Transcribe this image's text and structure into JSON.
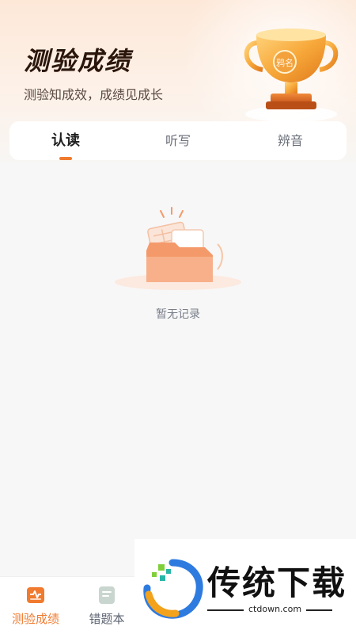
{
  "header": {
    "title": "测验成绩",
    "subtitle": "测验知成效，成绩见成长",
    "trophy_badge": "鸦名"
  },
  "tabs": [
    {
      "label": "认读",
      "active": true
    },
    {
      "label": "听写",
      "active": false
    },
    {
      "label": "辨音",
      "active": false
    }
  ],
  "empty_state": {
    "icon": "empty-folder-icon",
    "text": "暂无记录"
  },
  "bottom_nav": {
    "items": [
      {
        "label": "测验成绩",
        "icon": "report-icon",
        "active": true
      },
      {
        "label": "错题本",
        "icon": "notebook-icon",
        "active": false
      }
    ]
  },
  "watermark": {
    "text": "传统下载",
    "url": "ctdown.com"
  },
  "colors": {
    "accent": "#f07a2e",
    "title": "#2b160c",
    "text_muted": "#7a7f8a"
  }
}
